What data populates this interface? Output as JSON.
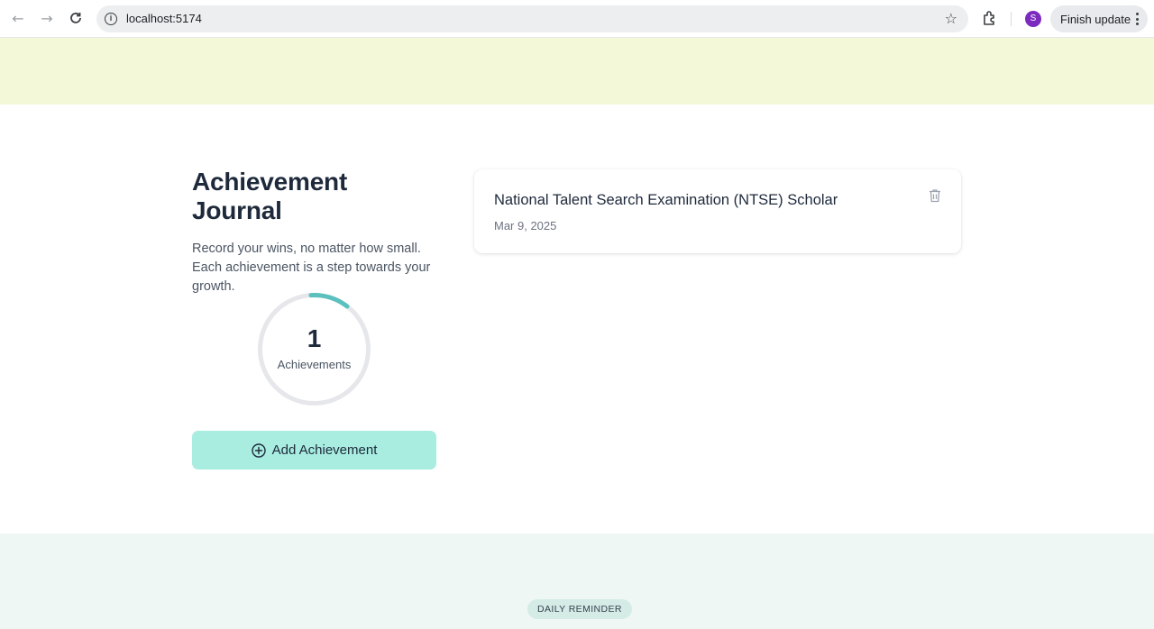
{
  "browser": {
    "url": "localhost:5174",
    "avatar_initial": "S",
    "finish_update_label": "Finish update"
  },
  "journal": {
    "title": "Achievement Journal",
    "description": "Record your wins, no matter how small. Each achievement is a step towards your growth.",
    "count": "1",
    "count_label": "Achievements",
    "add_button_label": "Add Achievement"
  },
  "achievements": [
    {
      "title": "National Talent Search Examination (NTSE) Scholar",
      "date": "Mar 9, 2025"
    }
  ],
  "footer": {
    "badge": "DAILY REMINDER"
  },
  "colors": {
    "accent": "#5bc0be",
    "top_band": "#f3f8d8",
    "button_bg": "#a8ede0",
    "bottom_band": "#eff7f5"
  }
}
